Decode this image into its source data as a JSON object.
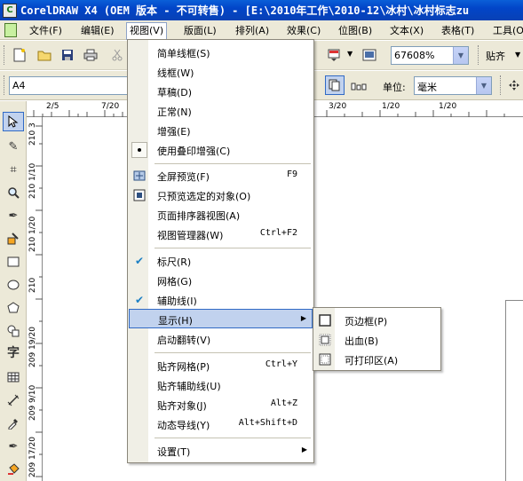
{
  "window": {
    "title": "CorelDRAW X4 (OEM 版本 - 不可转售) - [E:\\2010年工作\\2010-12\\冰村\\冰村标志zu",
    "app_icon_letter": "C"
  },
  "menubar": {
    "items": [
      "文件(F)",
      "编辑(E)",
      "视图(V)",
      "版面(L)",
      "排列(A)",
      "效果(C)",
      "位图(B)",
      "文本(X)",
      "表格(T)",
      "工具(O)"
    ],
    "active": "视图(V)"
  },
  "toolbar": {
    "zoom_value": "67608%",
    "snap_label": "贴齐"
  },
  "propertybar": {
    "page_size": "A4",
    "units_label": "单位:",
    "units_value": "毫米"
  },
  "ruler": {
    "h_labels": [
      "2/5",
      "7/20",
      "3/20",
      "1/20",
      "1/20"
    ],
    "v_labels": [
      "210 3",
      "210 1/10",
      "210 1/20",
      "210",
      "209 19/20",
      "209 9/10",
      "209 17/20"
    ]
  },
  "view_menu": {
    "items": [
      {
        "label": "简单线框(S)",
        "shortcut": "",
        "icon": ""
      },
      {
        "label": "线框(W)",
        "shortcut": "",
        "icon": ""
      },
      {
        "label": "草稿(D)",
        "shortcut": "",
        "icon": ""
      },
      {
        "label": "正常(N)",
        "shortcut": "",
        "icon": ""
      },
      {
        "label": "增强(E)",
        "shortcut": "",
        "icon": ""
      },
      {
        "label": "使用叠印增强(C)",
        "shortcut": "",
        "icon": "bullet-icon"
      },
      {
        "label": "全屏预览(F)",
        "shortcut": "F9",
        "icon": "fullscreen-preview-icon"
      },
      {
        "label": "只预览选定的对象(O)",
        "shortcut": "",
        "icon": "preview-selected-icon"
      },
      {
        "label": "页面排序器视图(A)",
        "shortcut": "",
        "icon": ""
      },
      {
        "label": "视图管理器(W)",
        "shortcut": "Ctrl+F2",
        "icon": ""
      },
      {
        "label": "标尺(R)",
        "shortcut": "",
        "icon": "check-icon"
      },
      {
        "label": "网格(G)",
        "shortcut": "",
        "icon": ""
      },
      {
        "label": "辅助线(I)",
        "shortcut": "",
        "icon": "check-icon"
      },
      {
        "label": "显示(H)",
        "shortcut": "",
        "icon": "",
        "submenu": true
      },
      {
        "label": "启动翻转(V)",
        "shortcut": "",
        "icon": ""
      },
      {
        "label": "贴齐网格(P)",
        "shortcut": "Ctrl+Y",
        "icon": ""
      },
      {
        "label": "贴齐辅助线(U)",
        "shortcut": "",
        "icon": ""
      },
      {
        "label": "贴齐对象(J)",
        "shortcut": "Alt+Z",
        "icon": ""
      },
      {
        "label": "动态导线(Y)",
        "shortcut": "Alt+Shift+D",
        "icon": ""
      },
      {
        "label": "设置(T)",
        "shortcut": "",
        "icon": "",
        "submenu": true
      }
    ]
  },
  "show_submenu": {
    "items": [
      {
        "label": "页边框(P)",
        "icon": "page-border-icon"
      },
      {
        "label": "出血(B)",
        "icon": "bleed-icon"
      },
      {
        "label": "可打印区(A)",
        "icon": "printable-area-icon"
      }
    ]
  },
  "colors": {
    "titlebar": "#0245c8",
    "highlight": "#c1d2ee",
    "highlight_border": "#316ac5",
    "chrome": "#ece9d8"
  }
}
